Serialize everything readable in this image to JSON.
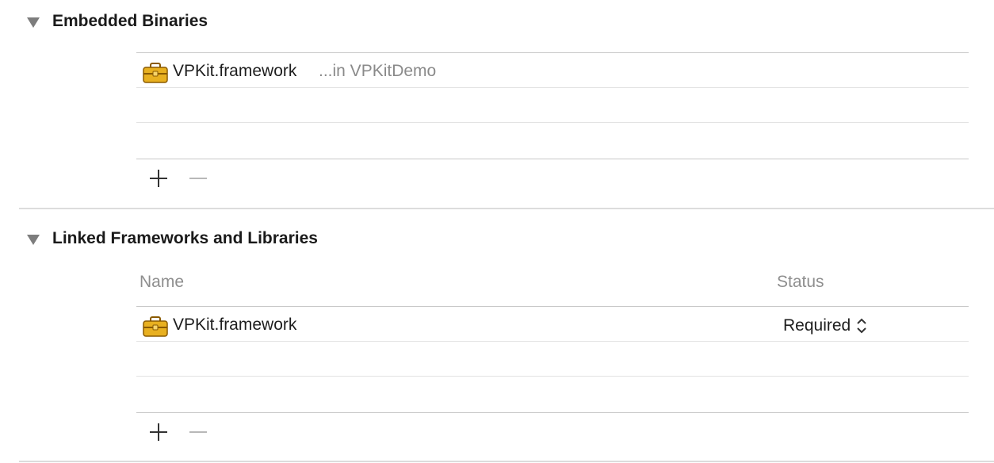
{
  "embedded": {
    "title": "Embedded Binaries",
    "items": [
      {
        "name": "VPKit.framework",
        "location": "...in VPKitDemo",
        "icon": "framework-toolbox-icon"
      }
    ],
    "add_icon": "plus-icon",
    "remove_icon": "minus-icon"
  },
  "linked": {
    "title": "Linked Frameworks and Libraries",
    "columns": {
      "name": "Name",
      "status": "Status"
    },
    "items": [
      {
        "name": "VPKit.framework",
        "status": "Required",
        "icon": "framework-toolbox-icon"
      }
    ],
    "add_icon": "plus-icon",
    "remove_icon": "minus-icon"
  },
  "colors": {
    "icon_gold": "#e8b020",
    "icon_dark": "#8a5a00",
    "header_grey": "#7d7d7d"
  }
}
